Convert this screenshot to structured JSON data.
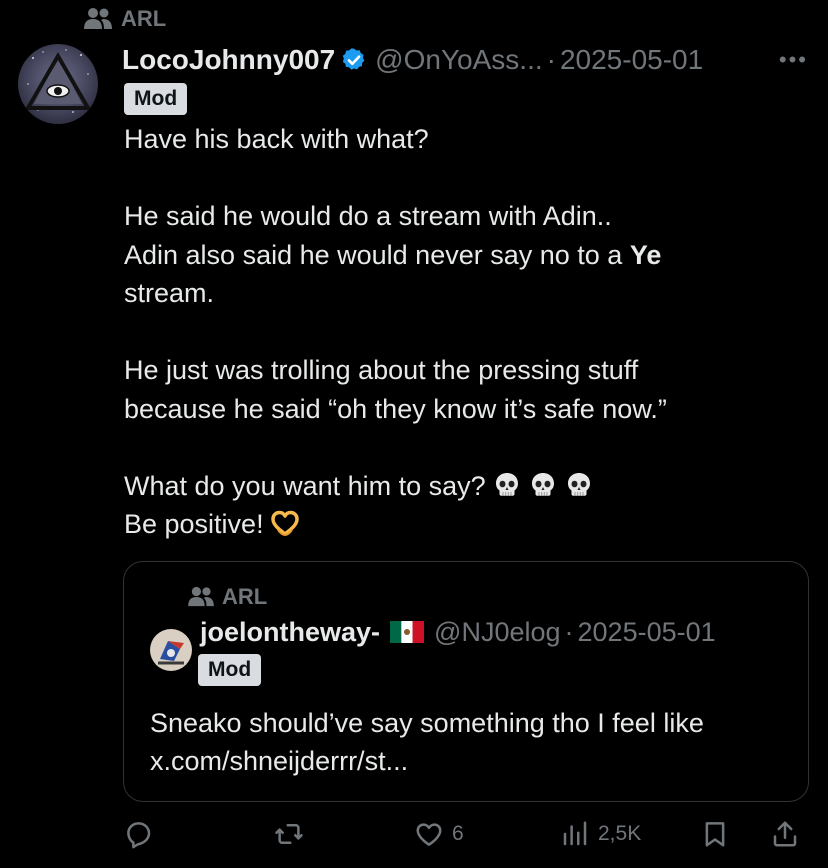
{
  "community": {
    "name": "ARL"
  },
  "tweet": {
    "display_name": "LocoJohnny007",
    "handle": "@OnYoAss...",
    "separator": "·",
    "date": "2025-05-01",
    "more_label": "•••",
    "badge": "Mod",
    "lines": {
      "l1": "Have his back with what?",
      "l2": "He said he would do a stream with Adin..",
      "l3_pre": "Adin also said he would never say no to a ",
      "l3_bold": "Ye",
      "l4": "stream.",
      "l5": "He just was trolling about the pressing stuff",
      "l6": "because he said “oh they know it’s safe now.”",
      "l7": "What do you want him to say?",
      "l8": "Be positive!"
    },
    "emoji_icons": [
      "skull-icon",
      "skull-icon",
      "skull-icon",
      "heart-hands-icon"
    ]
  },
  "quote": {
    "community": "ARL",
    "display_name": "joelontheway-",
    "flag_icon": "mexico-flag-icon",
    "handle": "@NJ0elog",
    "separator": "·",
    "date": "2025-05-01",
    "badge": "Mod",
    "text_l1": "Sneako should’ve say something tho I feel like",
    "text_l2": "x.com/shneijderrr/st..."
  },
  "actions": {
    "likes": "6",
    "views": "2,5K"
  },
  "colors": {
    "background": "#000000",
    "text": "#e7e9ea",
    "muted": "#71767b",
    "verified": "#1d9bf0",
    "badge_bg": "#d9dde1",
    "border": "#2f3336"
  }
}
